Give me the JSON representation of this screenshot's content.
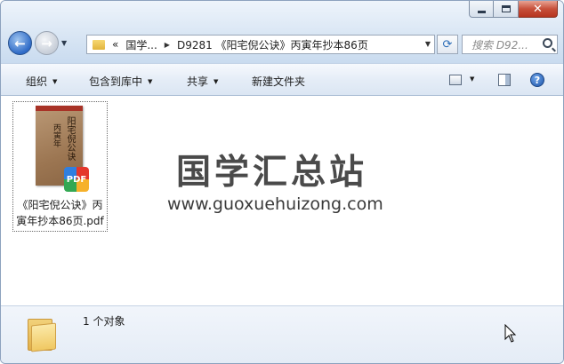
{
  "window": {
    "minimize_icon": "minimize-icon",
    "maximize_icon": "maximize-icon",
    "close_icon": "close-icon"
  },
  "nav": {
    "back": "←",
    "forward": "→"
  },
  "address": {
    "prefix": "«",
    "crumb1": "国学...",
    "crumb2": "D9281 《阳宅倪公诀》丙寅年抄本86页"
  },
  "search": {
    "placeholder": "搜索 D92..."
  },
  "toolbar": {
    "organize": "组织",
    "include_in_library": "包含到库中",
    "share": "共享",
    "new_folder": "新建文件夹",
    "help": "?"
  },
  "files": [
    {
      "name": "《阳宅倪公诀》丙寅年抄本86页.pdf",
      "badge": "PDF",
      "thumb_line1": "阳宅倪公诀",
      "thumb_line2": "丙寅年"
    }
  ],
  "watermark": {
    "cn": "国学汇总站",
    "url": "www.guoxuehuizong.com"
  },
  "status": {
    "item_count": "1 个对象"
  },
  "colors": {
    "accent": "#2f6bc7",
    "close_red": "#c7503a"
  }
}
